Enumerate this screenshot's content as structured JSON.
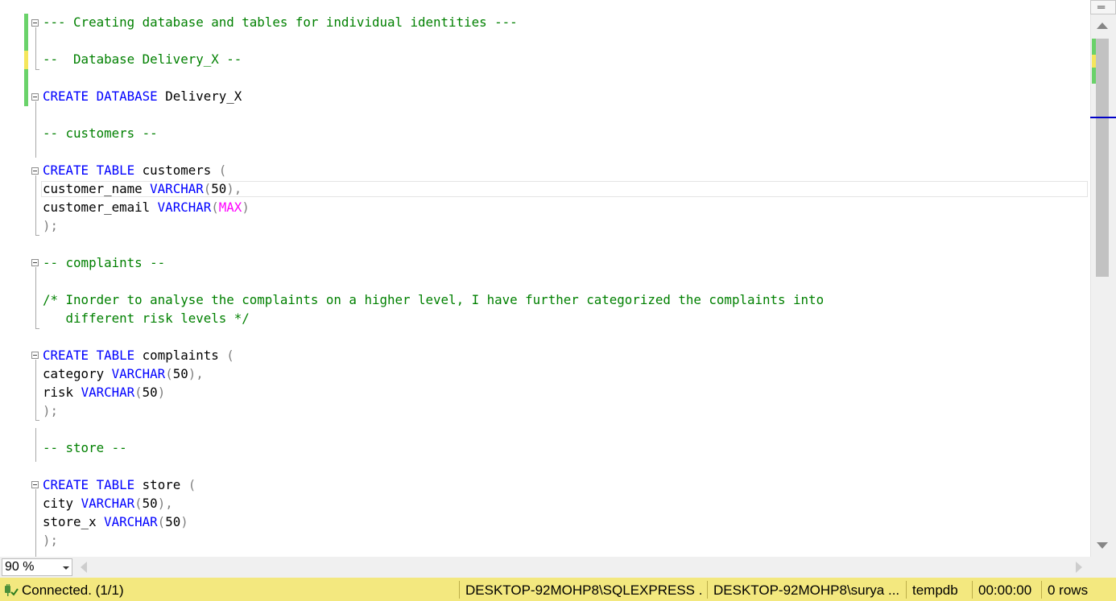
{
  "editor": {
    "lines": [
      {
        "tokens": [
          {
            "t": "--- Creating database and tables for individual identities ---",
            "c": "comment"
          }
        ]
      },
      {
        "tokens": []
      },
      {
        "tokens": [
          {
            "t": "--  Database Delivery_X --",
            "c": "comment"
          }
        ]
      },
      {
        "tokens": []
      },
      {
        "tokens": [
          {
            "t": "CREATE",
            "c": "keyword"
          },
          {
            "t": " ",
            "c": "ident"
          },
          {
            "t": "DATABASE",
            "c": "keyword"
          },
          {
            "t": " Delivery_X",
            "c": "ident"
          }
        ]
      },
      {
        "tokens": []
      },
      {
        "tokens": [
          {
            "t": "-- customers --",
            "c": "comment"
          }
        ]
      },
      {
        "tokens": []
      },
      {
        "tokens": [
          {
            "t": "CREATE",
            "c": "keyword"
          },
          {
            "t": " ",
            "c": "ident"
          },
          {
            "t": "TABLE",
            "c": "keyword"
          },
          {
            "t": " customers ",
            "c": "ident"
          },
          {
            "t": "(",
            "c": "punct"
          }
        ]
      },
      {
        "tokens": [
          {
            "t": "customer_name ",
            "c": "ident"
          },
          {
            "t": "VARCHAR",
            "c": "keyword"
          },
          {
            "t": "(",
            "c": "punct"
          },
          {
            "t": "50",
            "c": "ident"
          },
          {
            "t": "),",
            "c": "punct"
          }
        ]
      },
      {
        "tokens": [
          {
            "t": "customer_email ",
            "c": "ident"
          },
          {
            "t": "VARCHAR",
            "c": "keyword"
          },
          {
            "t": "(",
            "c": "punct"
          },
          {
            "t": "MAX",
            "c": "function"
          },
          {
            "t": ")",
            "c": "punct"
          }
        ]
      },
      {
        "tokens": [
          {
            "t": ");",
            "c": "punct"
          }
        ]
      },
      {
        "tokens": []
      },
      {
        "tokens": [
          {
            "t": "-- complaints --",
            "c": "comment"
          }
        ]
      },
      {
        "tokens": []
      },
      {
        "tokens": [
          {
            "t": "/* Inorder to analyse the complaints on a higher level, I have further categorized the complaints into",
            "c": "comment"
          }
        ]
      },
      {
        "tokens": [
          {
            "t": "   different risk levels */",
            "c": "comment"
          }
        ]
      },
      {
        "tokens": []
      },
      {
        "tokens": [
          {
            "t": "CREATE",
            "c": "keyword"
          },
          {
            "t": " ",
            "c": "ident"
          },
          {
            "t": "TABLE",
            "c": "keyword"
          },
          {
            "t": " complaints ",
            "c": "ident"
          },
          {
            "t": "(",
            "c": "punct"
          }
        ]
      },
      {
        "tokens": [
          {
            "t": "category ",
            "c": "ident"
          },
          {
            "t": "VARCHAR",
            "c": "keyword"
          },
          {
            "t": "(",
            "c": "punct"
          },
          {
            "t": "50",
            "c": "ident"
          },
          {
            "t": "),",
            "c": "punct"
          }
        ]
      },
      {
        "tokens": [
          {
            "t": "risk ",
            "c": "ident"
          },
          {
            "t": "VARCHAR",
            "c": "keyword"
          },
          {
            "t": "(",
            "c": "punct"
          },
          {
            "t": "50",
            "c": "ident"
          },
          {
            "t": ")",
            "c": "punct"
          }
        ]
      },
      {
        "tokens": [
          {
            "t": ");",
            "c": "punct"
          }
        ]
      },
      {
        "tokens": []
      },
      {
        "tokens": [
          {
            "t": "-- store --",
            "c": "comment"
          }
        ]
      },
      {
        "tokens": []
      },
      {
        "tokens": [
          {
            "t": "CREATE",
            "c": "keyword"
          },
          {
            "t": " ",
            "c": "ident"
          },
          {
            "t": "TABLE",
            "c": "keyword"
          },
          {
            "t": " store ",
            "c": "ident"
          },
          {
            "t": "(",
            "c": "punct"
          }
        ]
      },
      {
        "tokens": [
          {
            "t": "city ",
            "c": "ident"
          },
          {
            "t": "VARCHAR",
            "c": "keyword"
          },
          {
            "t": "(",
            "c": "punct"
          },
          {
            "t": "50",
            "c": "ident"
          },
          {
            "t": "),",
            "c": "punct"
          }
        ]
      },
      {
        "tokens": [
          {
            "t": "store_x ",
            "c": "ident"
          },
          {
            "t": "VARCHAR",
            "c": "keyword"
          },
          {
            "t": "(",
            "c": "punct"
          },
          {
            "t": "50",
            "c": "ident"
          },
          {
            "t": ")",
            "c": "punct"
          }
        ]
      },
      {
        "tokens": [
          {
            "t": ");",
            "c": "punct"
          }
        ]
      }
    ]
  },
  "zoom": {
    "value": "90 %"
  },
  "status": {
    "connection": "Connected. (1/1)",
    "server": "DESKTOP-92MOHP8\\SQLEXPRESS ...",
    "user": "DESKTOP-92MOHP8\\surya ...",
    "database": "tempdb",
    "elapsed": "00:00:00",
    "rows": "0 rows"
  },
  "icons": {
    "connection": "connected-plug-icon",
    "split": "split-window-icon"
  },
  "colors": {
    "keyword": "#0000ff",
    "comment": "#008000",
    "function": "#ff00ff",
    "punct": "#808080",
    "status_bar": "#f3e87f",
    "change_saved": "#6ad26a",
    "change_unsaved": "#f5e65c"
  }
}
